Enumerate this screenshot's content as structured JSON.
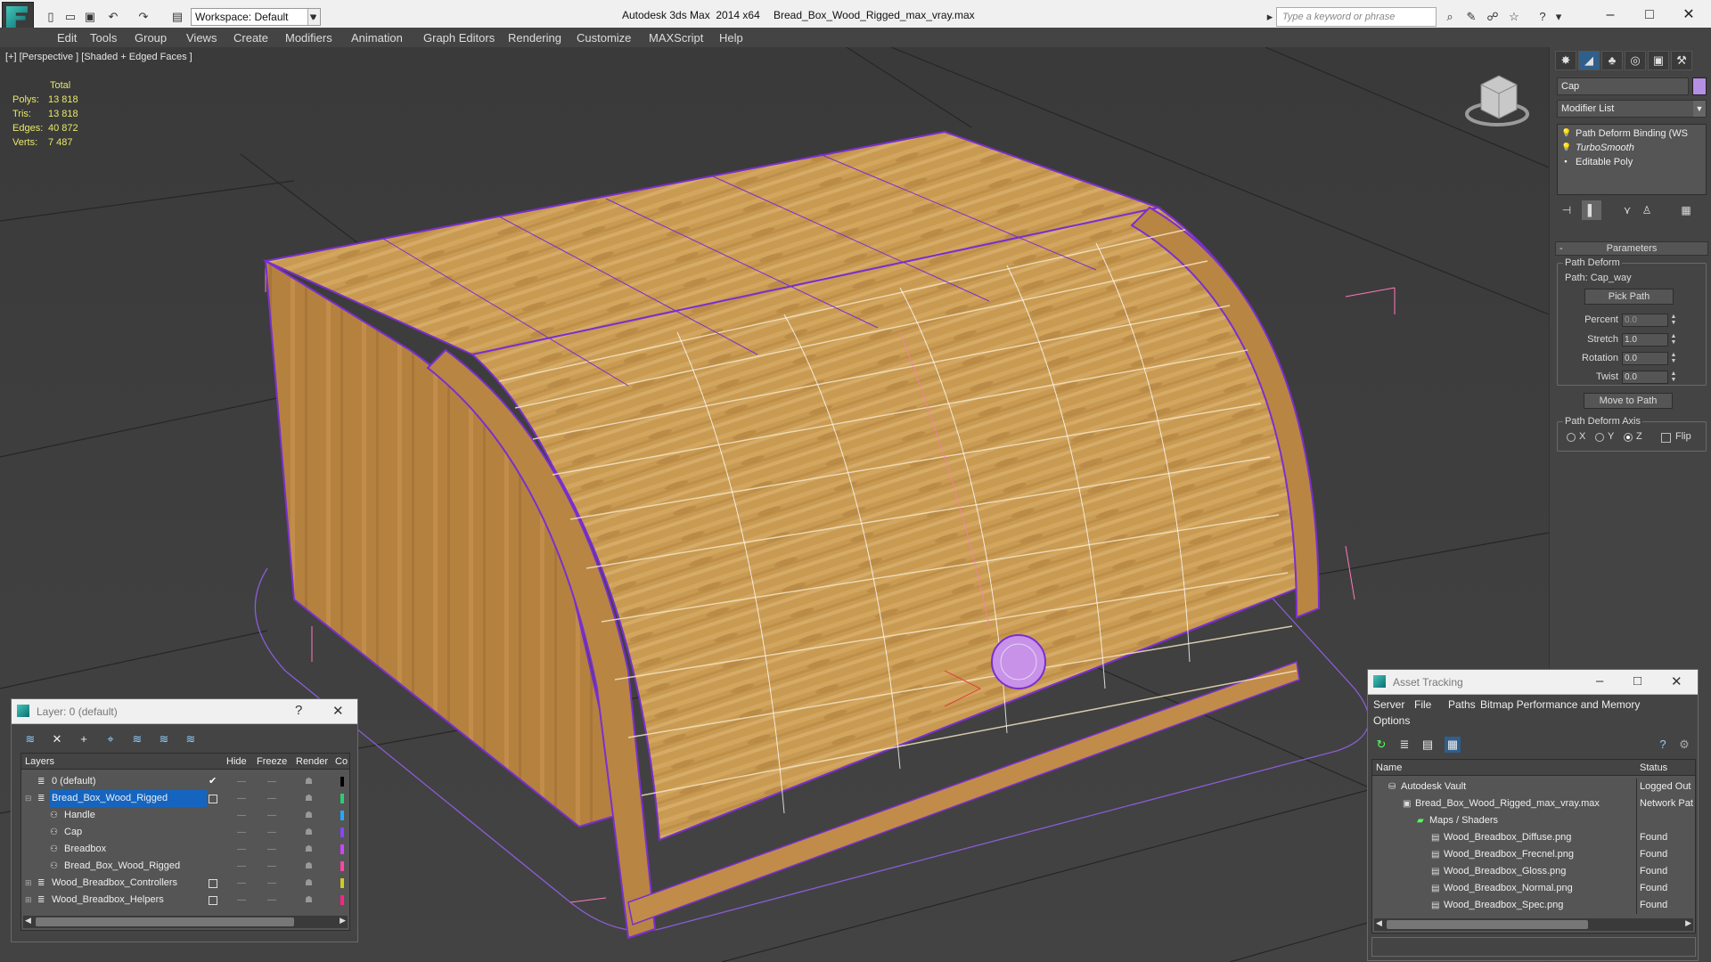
{
  "titlebar": {
    "workspace_label": "Workspace: Default",
    "app_title": "Autodesk 3ds Max  2014 x64",
    "file_title": "Bread_Box_Wood_Rigged_max_vray.max",
    "search_placeholder": "Type a keyword or phrase"
  },
  "menu": [
    "Edit",
    "Tools",
    "Group",
    "Views",
    "Create",
    "Modifiers",
    "Animation",
    "Graph Editors",
    "Rendering",
    "Customize",
    "MAXScript",
    "Help"
  ],
  "viewport": {
    "label": "[+] [Perspective ] [Shaded + Edged Faces ]",
    "stats": {
      "header": "Total",
      "rows": [
        {
          "label": "Polys:",
          "value": "13 818"
        },
        {
          "label": "Tris:",
          "value": "13 818"
        },
        {
          "label": "Edges:",
          "value": "40 872"
        },
        {
          "label": "Verts:",
          "value": "7 487"
        }
      ]
    }
  },
  "command_panel": {
    "object_name": "Cap",
    "object_color": "#b58fe6",
    "modifier_list": "Modifier List",
    "stack": [
      {
        "label": "Path Deform Binding (WS",
        "italic": false
      },
      {
        "label": "TurboSmooth",
        "italic": true
      },
      {
        "label": "Editable Poly",
        "italic": false
      }
    ],
    "rollout_title": "Parameters",
    "path_deform_group": "Path Deform",
    "path_label": "Path: Cap_way",
    "pick_path": "Pick Path",
    "percent_label": "Percent",
    "percent_value": "0.0",
    "stretch_label": "Stretch",
    "stretch_value": "1.0",
    "rotation_label": "Rotation",
    "rotation_value": "0.0",
    "twist_label": "Twist",
    "twist_value": "0.0",
    "move_to_path": "Move to Path",
    "axis_group": "Path Deform Axis",
    "axis_x": "X",
    "axis_y": "Y",
    "axis_z": "Z",
    "flip": "Flip"
  },
  "layer_dialog": {
    "title": "Layer: 0 (default)",
    "columns": [
      "Layers",
      "Hide",
      "Freeze",
      "Render",
      "Co"
    ],
    "rows": [
      {
        "name": "0 (default)",
        "indent": 0,
        "selected": false
      },
      {
        "name": "Bread_Box_Wood_Rigged",
        "indent": 0,
        "selected": true
      },
      {
        "name": "Handle",
        "indent": 1,
        "selected": false
      },
      {
        "name": "Cap",
        "indent": 1,
        "selected": false
      },
      {
        "name": "Breadbox",
        "indent": 1,
        "selected": false
      },
      {
        "name": "Bread_Box_Wood_Rigged",
        "indent": 1,
        "selected": false
      },
      {
        "name": "Wood_Breadbox_Controllers",
        "indent": 0,
        "selected": false
      },
      {
        "name": "Wood_Breadbox_Helpers",
        "indent": 0,
        "selected": false
      }
    ]
  },
  "asset_dialog": {
    "title": "Asset Tracking",
    "menu": [
      "Server",
      "File",
      "Paths",
      "Bitmap Performance and Memory",
      "Options"
    ],
    "columns": [
      "Name",
      "Status"
    ],
    "rows": [
      {
        "name": "Autodesk Vault",
        "status": "Logged Out",
        "indent": 1
      },
      {
        "name": "Bread_Box_Wood_Rigged_max_vray.max",
        "status": "Network Pat",
        "indent": 2
      },
      {
        "name": "Maps / Shaders",
        "status": "",
        "indent": 3
      },
      {
        "name": "Wood_Breadbox_Diffuse.png",
        "status": "Found",
        "indent": 4
      },
      {
        "name": "Wood_Breadbox_Frecnel.png",
        "status": "Found",
        "indent": 4
      },
      {
        "name": "Wood_Breadbox_Gloss.png",
        "status": "Found",
        "indent": 4
      },
      {
        "name": "Wood_Breadbox_Normal.png",
        "status": "Found",
        "indent": 4
      },
      {
        "name": "Wood_Breadbox_Spec.png",
        "status": "Found",
        "indent": 4
      }
    ]
  }
}
